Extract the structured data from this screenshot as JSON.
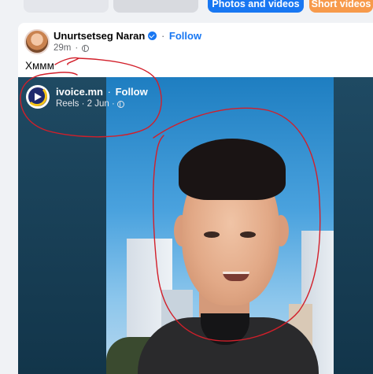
{
  "composer": {
    "photos_label": "Photos and videos",
    "short_label": "Short videos"
  },
  "post": {
    "author": "Unurtsetseg Naran",
    "follow_label": "Follow",
    "separator": "·",
    "time": "29m",
    "text": "Хммм"
  },
  "shared_reel": {
    "author": "ivoice.mn",
    "follow_label": "Follow",
    "separator": "·",
    "meta": "Reels · 2 Jun ·"
  },
  "colors": {
    "accent": "#1877f2",
    "annotation": "#d21f2a"
  }
}
